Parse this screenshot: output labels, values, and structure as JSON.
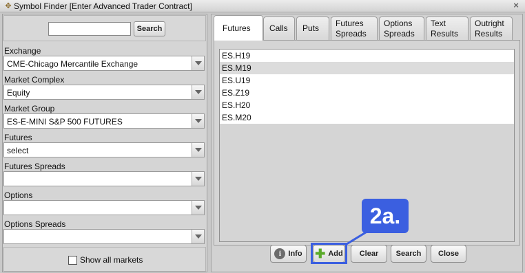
{
  "window": {
    "title": "Symbol Finder [Enter Advanced Trader Contract]"
  },
  "left": {
    "search": {
      "value": "",
      "button": "Search"
    },
    "fields": [
      {
        "label": "Exchange",
        "value": "CME-Chicago Mercantile Exchange"
      },
      {
        "label": "Market Complex",
        "value": "Equity"
      },
      {
        "label": "Market Group",
        "value": "ES-E-MINI S&P 500 FUTURES"
      },
      {
        "label": "Futures",
        "value": "select"
      },
      {
        "label": "Futures Spreads",
        "value": ""
      },
      {
        "label": "Options",
        "value": ""
      },
      {
        "label": "Options Spreads",
        "value": ""
      }
    ],
    "show_all": {
      "label": "Show all markets",
      "checked": false
    }
  },
  "tabs": [
    {
      "label": "Futures",
      "active": true
    },
    {
      "label": "Calls",
      "active": false
    },
    {
      "label": "Puts",
      "active": false
    },
    {
      "label": "Futures\nSpreads",
      "active": false
    },
    {
      "label": "Options\nSpreads",
      "active": false
    },
    {
      "label": "Text\nResults",
      "active": false
    },
    {
      "label": "Outright\nResults",
      "active": false
    }
  ],
  "results": {
    "items": [
      "ES.H19",
      "ES.M19",
      "ES.U19",
      "ES.Z19",
      "ES.H20",
      "ES.M20"
    ],
    "selected_index": 1
  },
  "buttons": {
    "info": "Info",
    "add": "Add",
    "clear": "Clear",
    "search": "Search",
    "close": "Close"
  },
  "annotation": {
    "label": "2a.",
    "color": "#3b5fe0"
  },
  "icons": {
    "title": "gear-icon",
    "close": "close-icon",
    "info": "info-icon",
    "add": "plus-icon",
    "dropdown": "chevron-down-icon"
  }
}
